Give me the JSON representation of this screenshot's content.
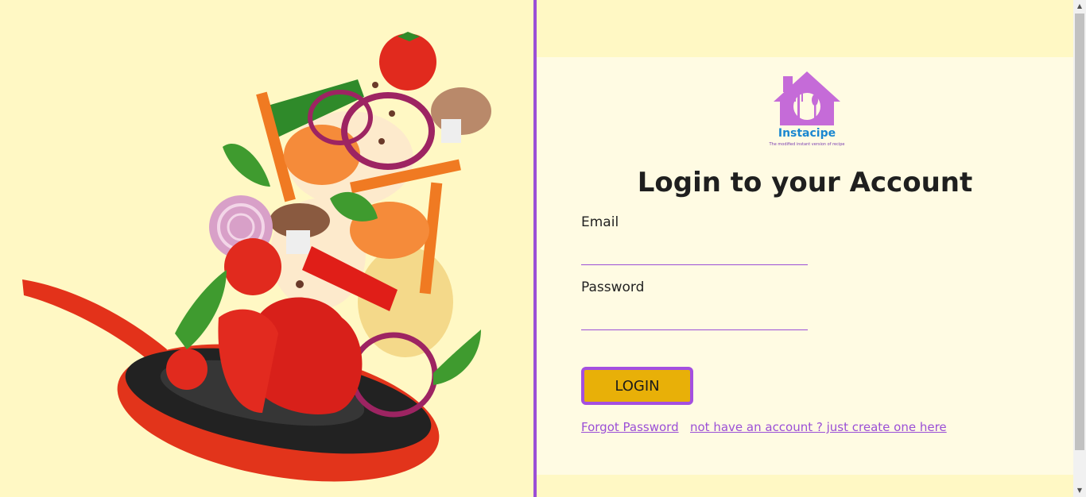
{
  "brand": {
    "name": "Instacipe",
    "tagline": "The modified instant version of recipe"
  },
  "login": {
    "title": "Login to your Account",
    "email_label": "Email",
    "email_value": "",
    "password_label": "Password",
    "password_value": "",
    "button_label": "LOGIN",
    "forgot_link": "Forgot Password",
    "signup_link": "not have an account ? just create one here"
  },
  "illustration": {
    "subject": "vegetables flying out of a red frying pan"
  },
  "colors": {
    "background": "#fff8c4",
    "card": "#fffbe3",
    "accent": "#9b4fd6",
    "button": "#e8b008",
    "logo": "#c56bd8"
  }
}
